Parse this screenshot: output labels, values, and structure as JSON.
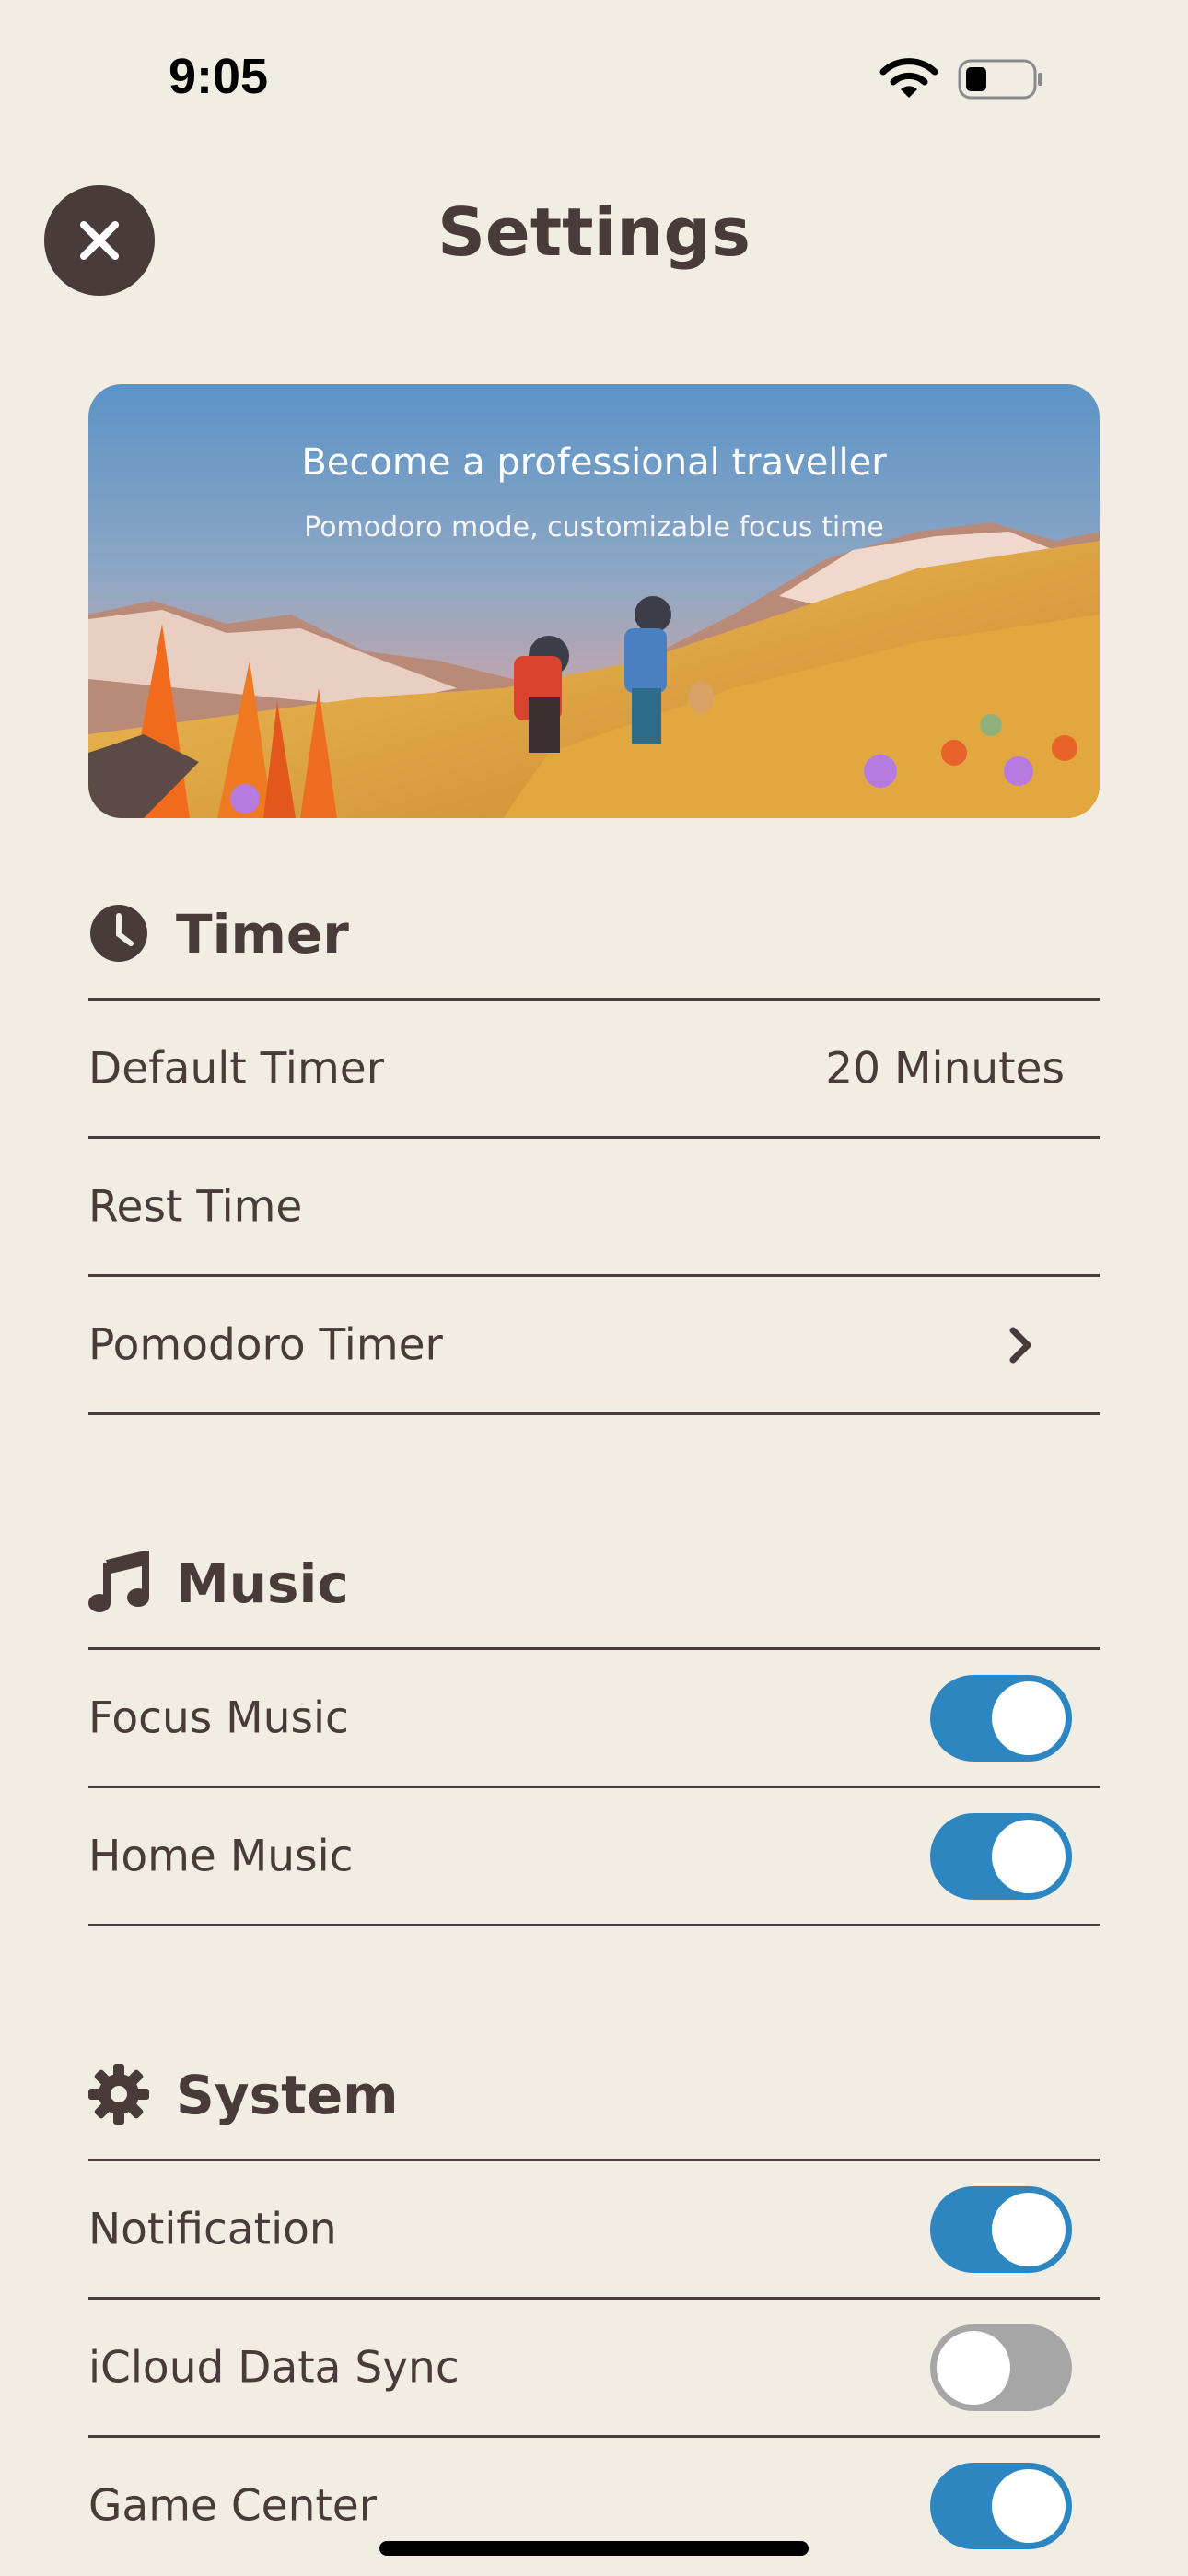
{
  "status_bar": {
    "time": "9:05"
  },
  "header": {
    "title": "Settings"
  },
  "banner": {
    "title": "Become a professional traveller",
    "subtitle": "Pomodoro mode, customizable focus time"
  },
  "sections": {
    "timer": {
      "title": "Timer",
      "icon": "clock-icon",
      "rows": [
        {
          "label": "Default Timer",
          "value": "20 Minutes"
        },
        {
          "label": "Rest Time"
        },
        {
          "label": "Pomodoro Timer",
          "icon": "chevron-right-icon"
        }
      ]
    },
    "music": {
      "title": "Music",
      "icon": "music-note-icon",
      "rows": [
        {
          "label": "Focus Music",
          "enabled": true
        },
        {
          "label": "Home Music",
          "enabled": true
        }
      ]
    },
    "system": {
      "title": "System",
      "icon": "gear-icon",
      "rows": [
        {
          "label": "Notification",
          "enabled": true
        },
        {
          "label": "iCloud Data Sync",
          "enabled": false
        },
        {
          "label": "Game Center",
          "enabled": true
        }
      ]
    }
  },
  "colors": {
    "background": "#f2ede3",
    "text": "#483b39",
    "toggle_on": "#2e86c1",
    "toggle_off": "#a6a6a6"
  }
}
